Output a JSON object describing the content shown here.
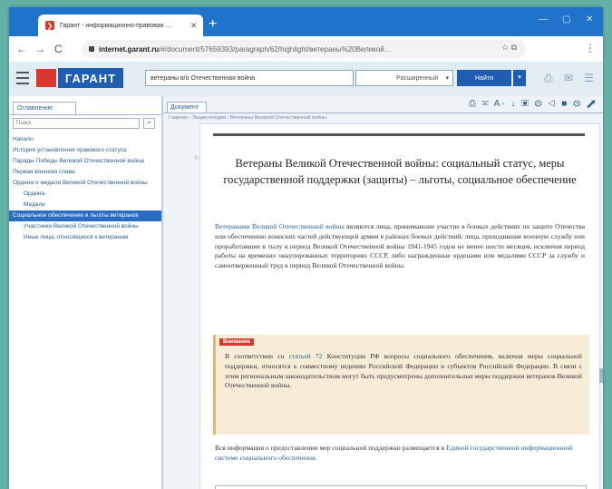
{
  "browser": {
    "tab_title": "Гарант - информационно-правовая …",
    "tab_close": "✕",
    "new_tab": "+",
    "url_host": "internet.garant.ru",
    "url_path": "/#/document/57659393/paragraph/62/highlight/ветераны%20Великой…",
    "nav_back": "←",
    "nav_forward": "→",
    "reload": "C",
    "menu": "⋮",
    "url_icons": "☆  ⧉"
  },
  "window_controls": {
    "minimize": "—",
    "maximize": "▢",
    "close": "✕"
  },
  "toolbar": {
    "logo": "ГАРАНТ",
    "search_value": "ветераны в/о Отечественная война",
    "scope_value": "Расширенный",
    "scope_arrow": "▾",
    "find_button": "Найти",
    "find_dropdown": "▾",
    "icon_1": "⎙",
    "icon_2": "✉",
    "icon_3": "☰"
  },
  "left_panel": {
    "tab_label": "Оглавление",
    "search_placeholder": "Поиск",
    "search_button": "⌕",
    "items": [
      {
        "label": "Начало",
        "level": 1
      },
      {
        "label": "История установления правового статуса",
        "level": 1
      },
      {
        "label": "Парады Победы Великой Отечественной войны",
        "level": 1
      },
      {
        "label": "Первая военная слава",
        "level": 1
      },
      {
        "label": "Ордена и медали Великой Отечественной войны",
        "level": 1
      },
      {
        "label": "Ордена",
        "level": 2
      },
      {
        "label": "Медали",
        "level": 2
      },
      {
        "label": "Социальное обеспечение и льготы ветеранов",
        "level": 1,
        "active": true
      },
      {
        "label": "Участники Великой Отечественной войны",
        "level": 2
      },
      {
        "label": "Иные лица, относящиеся к ветеранам",
        "level": 2
      }
    ]
  },
  "document": {
    "tab_label": "Документ",
    "tools": "⎙ ✉ A- ↓ ▣ ⚙ ◁ ■ ⚙ ⬈",
    "breadcrumb": "Главная › Энциклопедия › Ветераны Великой Отечественной войны",
    "star": "☆",
    "title": "Ветераны Великой Отечественной войны: социальный статус, меры государственной поддержки (защиты) – льготы, социальное обеспечение",
    "para1_link": "Ветеранами Великой Отечественной войны",
    "para1_text": " являются лица, принимавшие участие в боевых действиях по защите Отечества или обеспечению воинских частей действующей армии в районах боевых действий; лица, проходившие военную службу или проработавшие в тылу в период Великой Отечественной войны 1941-1945 годов не менее шести месяцев, исключая период работы на временно оккупированных территориях СССР, либо награжденные орденами или медалями СССР за службу и самоотверженный труд в период Великой Отечественной войны.",
    "note_badge": "Внимание",
    "note_pre": "В соответствии со ",
    "note_link": "статьей 72",
    "note_post": " Конституции РФ вопросы социального обеспечения, включая меры социальной поддержки, относятся к совместному ведению Российской Федерации и субъектов Российской Федерации. В связи с этим региональным законодательством могут быть предусмотрены дополнительные меры поддержки ветеранов Великой Отечественной войны.",
    "para2_text": "Вся информация о предоставлении мер социальной поддержки размещается в ",
    "para2_link": "Единой государственной информационной системе социального обеспечения."
  }
}
